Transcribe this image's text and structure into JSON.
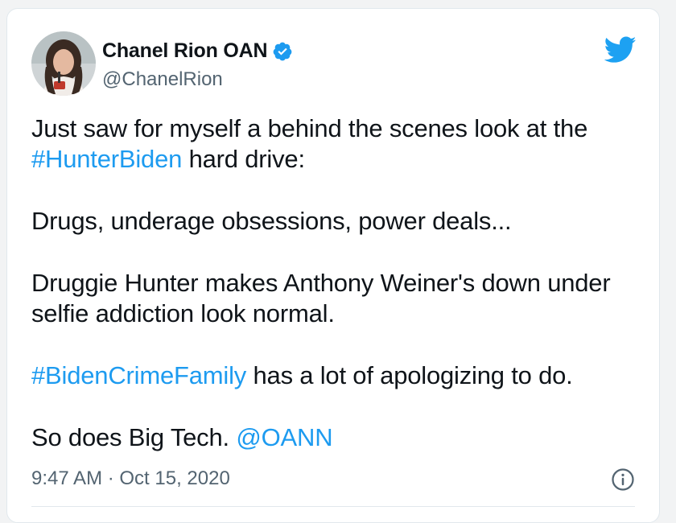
{
  "tweet": {
    "author": {
      "display_name": "Chanel Rion OAN",
      "handle": "@ChanelRion",
      "verified": true,
      "avatar_icon": "profile-photo"
    },
    "body": {
      "p1_text": "Just saw for myself a behind the scenes look at the",
      "p1_hashtag": "#HunterBiden",
      "p1_rest": " hard drive:",
      "p2": "Drugs, underage obsessions, power deals...",
      "p3_line1": "Druggie Hunter makes Anthony Weiner's down under",
      "p3_line2": "selfie addiction look normal.",
      "p4_hashtag": "#BidenCrimeFamily",
      "p4_rest": " has a lot of apologizing to do.",
      "p5_text": "So does Big Tech. ",
      "p5_mention": "@OANN"
    },
    "timestamp": "9:47 AM · Oct 15, 2020",
    "icons": {
      "logo": "twitter-bird-icon",
      "verified": "verified-badge-icon",
      "info": "info-icon"
    },
    "colors": {
      "link": "#1d9bf0",
      "brand": "#1da1f2",
      "muted": "#536471",
      "text": "#0f1419"
    }
  }
}
